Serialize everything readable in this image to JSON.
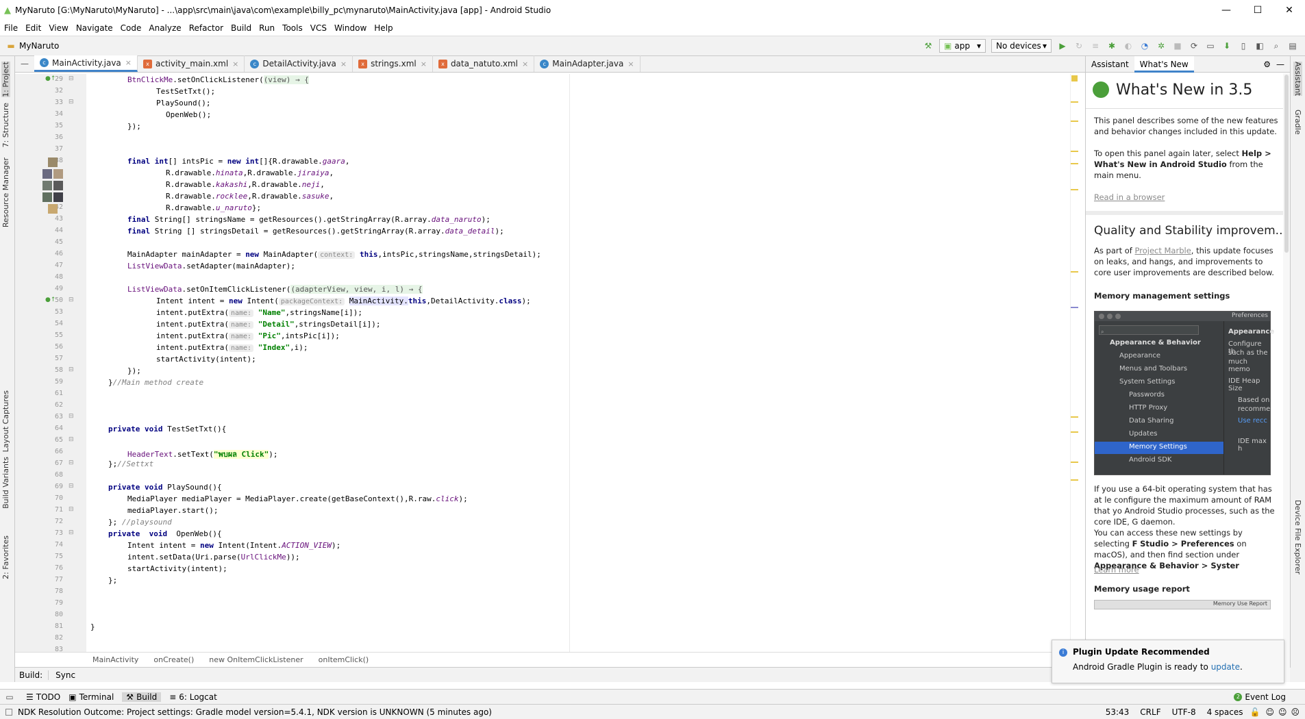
{
  "window": {
    "title": "MyNaruto [G:\\MyNaruto\\MyNaruto] - ...\\app\\src\\main\\java\\com\\example\\billy_pc\\mynaruto\\MainActivity.java [app] - Android Studio"
  },
  "menu": [
    "File",
    "Edit",
    "View",
    "Navigate",
    "Code",
    "Analyze",
    "Refactor",
    "Build",
    "Run",
    "Tools",
    "VCS",
    "Window",
    "Help"
  ],
  "nav": {
    "project": "MyNaruto",
    "run_config": "app",
    "devices": "No devices"
  },
  "tabs": [
    "MainActivity.java",
    "activity_main.xml",
    "DetailActivity.java",
    "strings.xml",
    "data_natuto.xml",
    "MainAdapter.java"
  ],
  "left_tools": [
    "1: Project",
    "7: Structure",
    "Resource Manager",
    "Layout Captures",
    "Build Variants",
    "2: Favorites"
  ],
  "right_tools": [
    "Assistant",
    "Gradle",
    "Device File Explorer"
  ],
  "editor": {
    "line_numbers": [
      "29",
      "32",
      "33",
      "34",
      "35",
      "36",
      "37",
      "38",
      "39",
      "40",
      "41",
      "42",
      "43",
      "44",
      "45",
      "46",
      "47",
      "48",
      "49",
      "50",
      "53",
      "54",
      "55",
      "56",
      "57",
      "58",
      "59",
      "61",
      "62",
      "63",
      "64",
      "65",
      "66",
      "67",
      "68",
      "69",
      "70",
      "71",
      "72",
      "73",
      "74",
      "75",
      "76",
      "77",
      "78",
      "79",
      "80",
      "81",
      "82",
      "83"
    ],
    "l29a": "BtnClickMe",
    "l29b": ".setOnClickListener(",
    "l29c": "(view) → {",
    "l32": "TestSetTxt();",
    "l33": "PlaySound();",
    "l34": "OpenWeb();",
    "l35": "});",
    "l39a": "final int",
    "l39b": "[] intsPic = ",
    "l39c": "new int",
    "l39d": "[]{R.drawable.",
    "l39e": "gaara",
    "l40a": "R.drawable.",
    "l40b": "hinata",
    "l40c": ",R.drawable.",
    "l40d": "jiraiya",
    "l41a": "R.drawable.",
    "l41b": "kakashi",
    "l41c": ",R.drawable.",
    "l41d": "neji",
    "l42a": "R.drawable.",
    "l42b": "rocklee",
    "l42c": ",R.drawable.",
    "l42d": "sasuke",
    "l43a": "R.drawable.",
    "l43b": "u_naruto",
    "l43c": "};",
    "l44a": "final",
    "l44b": " String[] stringsName = getResources().getStringArray(R.array.",
    "l44c": "data_naruto",
    "l44d": ");",
    "l45a": "final",
    "l45b": " String [] stringsDetail = getResources().getStringArray(R.array.",
    "l45c": "data_detail",
    "l45d": ");",
    "l47a": "MainAdapter mainAdapter = ",
    "l47b": "new",
    "l47c": " MainAdapter(",
    "l47h": "context:",
    "l47d": "this",
    "l47e": ",intsPic,stringsName,stringsDetail);",
    "l48a": "ListViewData",
    "l48b": ".setAdapter(mainAdapter);",
    "l50a": "ListViewData",
    "l50b": ".setOnItemClickListener(",
    "l50c": "(adapterView, view, i, l) → {",
    "l53a": "Intent intent = ",
    "l53b": "new",
    "l53c": " Intent(",
    "l53h": "packageContext:",
    "l53d": "MainActivity.",
    "l53e": "this",
    "l53f": ",DetailActivity.",
    "l53g": "class",
    "l53i": ");",
    "l54a": "intent.putExtra(",
    "l54h": "name:",
    "l54b": "\"Name\"",
    "l54c": ",stringsName[i]);",
    "l55a": "intent.putExtra(",
    "l55h": "name:",
    "l55b": "\"Detail\"",
    "l55c": ",stringsDetail[i]);",
    "l56a": "intent.putExtra(",
    "l56h": "name:",
    "l56b": "\"Pic\"",
    "l56c": ",intsPic[i]);",
    "l57a": "intent.putExtra(",
    "l57h": "name:",
    "l57b": "\"Index\"",
    "l57c": ",i);",
    "l58": "startActivity(intent);",
    "l59": "});",
    "l61a": "}",
    "l61b": "//Main method create",
    "l65a": "private void",
    "l65b": " TestSetTxt(){",
    "l67a": "HeaderText",
    "l67b": ".setText(",
    "l67c": "\"พบผล Click\"",
    "l67d": ");",
    "l68a": "};",
    "l68b": "//Settxt",
    "l70a": "private void",
    "l70b": " PlaySound(){",
    "l71a": "MediaPlayer mediaPlayer = MediaPlayer.create(getBaseContext(),R.raw.",
    "l71b": "click",
    "l71c": ");",
    "l72": "mediaPlayer.start();",
    "l73a": "};",
    "l73b": " //playsound",
    "l74a": "private  void",
    "l74b": "  OpenWeb(){",
    "l75a": "Intent intent = ",
    "l75b": "new",
    "l75c": " Intent(Intent.",
    "l75d": "ACTION_VIEW",
    "l75e": ");",
    "l76a": "intent.setData(Uri.parse(",
    "l76b": "UrlClickMe",
    "l76c": "));",
    "l77": "startActivity(intent);",
    "l78": "};",
    "l82": "}"
  },
  "breadcrumb": [
    "MainActivity",
    "onCreate()",
    "new OnItemClickListener",
    "onItemClick()"
  ],
  "build": {
    "label": "Build:",
    "tab": "Sync"
  },
  "bottom_tabs": [
    "TODO",
    "Terminal",
    "Build",
    "6: Logcat"
  ],
  "event_log": "Event Log",
  "status": {
    "message": "NDK Resolution Outcome: Project settings: Gradle model version=5.4.1, NDK version is UNKNOWN (5 minutes ago)",
    "position": "53:43",
    "line_sep": "CRLF",
    "encoding": "UTF-8",
    "indent": "4 spaces"
  },
  "panel": {
    "tabs": [
      "Assistant",
      "What's New"
    ],
    "heading": "What's New in 3.5",
    "intro": "This panel describes some of the new features and behavior changes included in this update.",
    "reopen1": "To open this panel again later, select ",
    "reopen_bold": "Help > What's New in Android Studio",
    "reopen2": " from the main menu.",
    "read_link": "Read in a browser",
    "section": "Quality and Stability improvem...",
    "marble1": "As part of ",
    "marble_link": "Project Marble",
    "marble2": ", this update focuses on leaks, and hangs, and improvements to core user improvements are described below.",
    "mem_heading": "Memory management settings",
    "pref": {
      "title": "Preferences",
      "tree": [
        "Appearance & Behavior",
        "Appearance",
        "Menus and Toolbars",
        "System Settings",
        "Passwords",
        "HTTP Proxy",
        "Data Sharing",
        "Updates",
        "Memory Settings",
        "Android SDK"
      ],
      "right": [
        "Appearance",
        "Configure th",
        "such as the",
        "much memo",
        "IDE Heap Size",
        "Based on",
        "recomme",
        "Use recc",
        "IDE max h"
      ]
    },
    "para64": "If you use a 64-bit operating system that has at le configure the maximum amount of RAM that yo Android Studio processes, such as the core IDE, G daemon.",
    "access1": "You can access these new settings by selecting ",
    "access_bold1": "F",
    "access2": "Studio > Preferences",
    "access3": " on macOS), and then find section under ",
    "access_bold2": "Appearance & Behavior > Syster",
    "learn_more": "Learn more",
    "usage_heading": "Memory usage report",
    "usage_img": "Memory Use Report"
  },
  "notification": {
    "title": "Plugin Update Recommended",
    "body": "Android Gradle Plugin is ready to ",
    "link": "update",
    "end": "."
  }
}
